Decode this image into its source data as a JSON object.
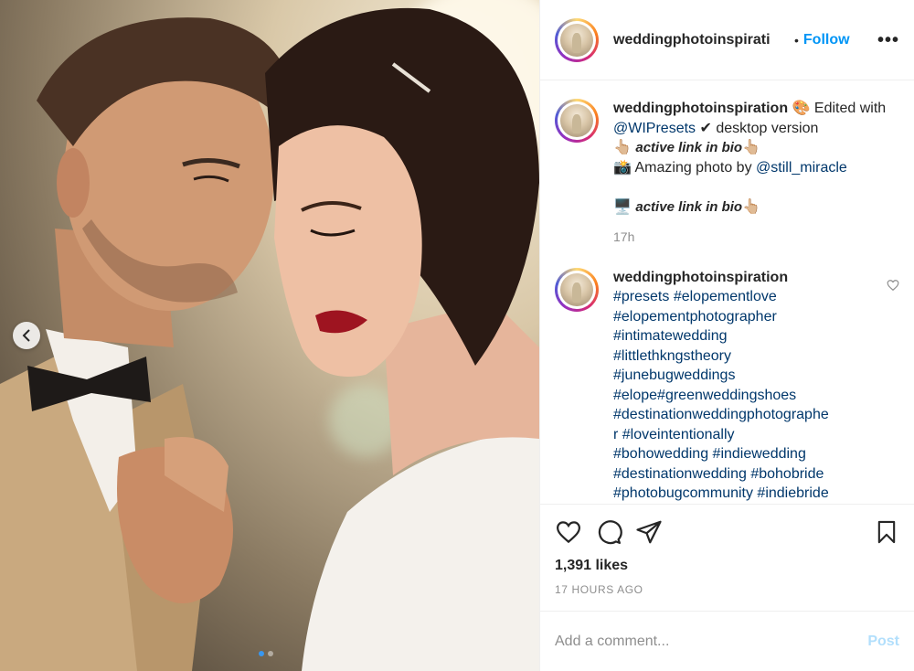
{
  "post": {
    "username": "weddingphotoinspiration",
    "header_username_display": "weddingphotoinspirati",
    "dot": "•",
    "follow_label": "Follow",
    "more_label": "•••"
  },
  "caption": {
    "user": "weddingphotoinspiration",
    "palette_emoji": "🎨",
    "text_1": " Edited with ",
    "mention_1": "@WIPresets",
    "check_emoji": "✔",
    "text_2": " desktop version",
    "point_emoji": "👆🏼",
    "active_link": "active link in bio",
    "point_emoji_2": "👆🏼",
    "camera_emoji": "📸",
    "text_3": " Amazing photo by ",
    "mention_2": "@still_miracle",
    "computer_emoji": "🖥️",
    "active_link_2": "active link in bio",
    "point_emoji_3": "👆🏼",
    "time": "17h"
  },
  "hashtag_comment": {
    "user": "weddingphotoinspiration",
    "lines": [
      "#presets #elopementlove",
      "#elopementphotographer",
      "#intimatewedding",
      "#littlethkngstheory",
      "#junebugweddings",
      "#elope#greenweddingshoes",
      "#destinationweddingphotographe",
      "r #loveintentionally",
      "#bohowedding #indiewedding",
      "#destinationwedding #bohobride",
      "#photobugcommunity #indiebride"
    ]
  },
  "actions": {
    "likes": "1,391 likes",
    "time_ago": "17 HOURS AGO"
  },
  "comment_box": {
    "placeholder": "Add a comment...",
    "post_label": "Post"
  },
  "colors": {
    "link": "#00376b",
    "follow": "#0095f6",
    "post_disabled": "#b2dffc",
    "muted": "#8e8e8e"
  }
}
